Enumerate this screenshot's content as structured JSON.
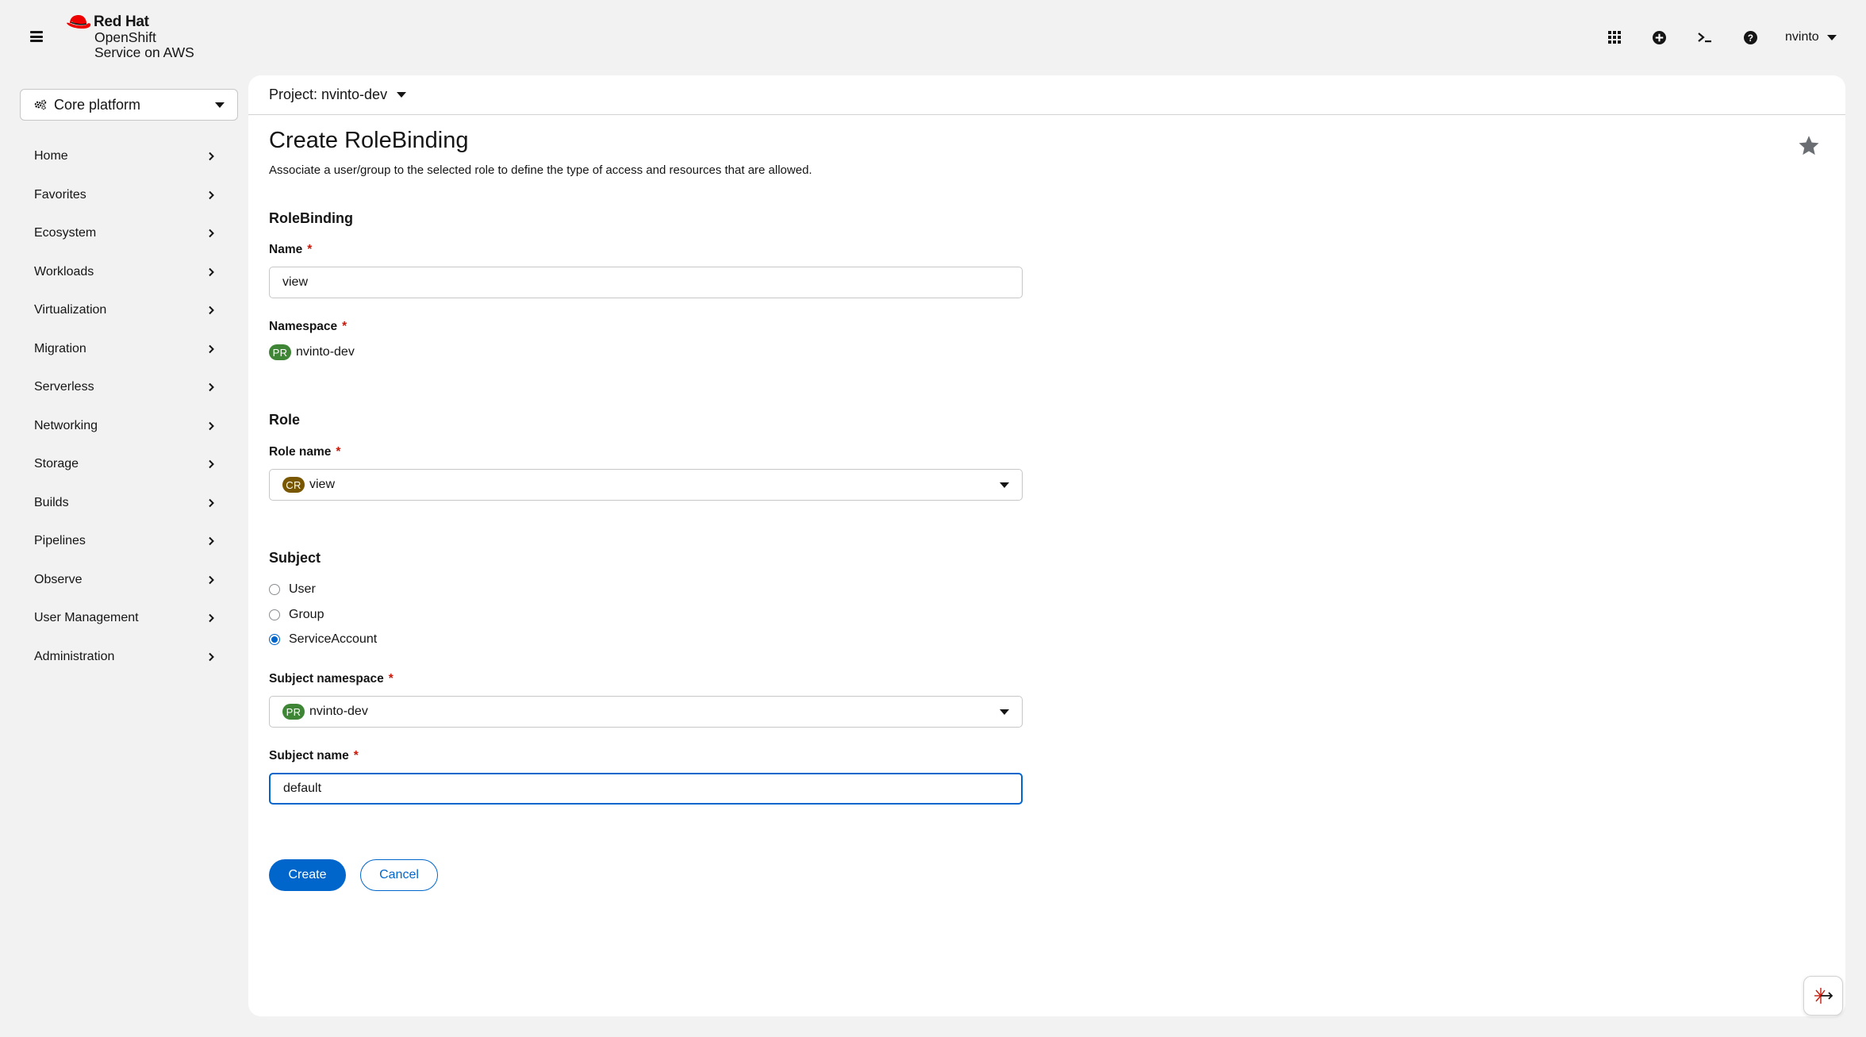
{
  "brand": {
    "company": "Red Hat",
    "product_line1": "OpenShift",
    "product_line2": "Service on AWS"
  },
  "masthead": {
    "icons": [
      "apps-grid-icon",
      "plus-circle-icon",
      "terminal-icon",
      "help-icon"
    ],
    "user": "nvinto"
  },
  "perspective": {
    "label": "Core platform"
  },
  "nav": {
    "items": [
      {
        "label": "Home"
      },
      {
        "label": "Favorites"
      },
      {
        "label": "Ecosystem"
      },
      {
        "label": "Workloads"
      },
      {
        "label": "Virtualization"
      },
      {
        "label": "Migration"
      },
      {
        "label": "Serverless"
      },
      {
        "label": "Networking"
      },
      {
        "label": "Storage"
      },
      {
        "label": "Builds"
      },
      {
        "label": "Pipelines"
      },
      {
        "label": "Observe"
      },
      {
        "label": "User Management"
      },
      {
        "label": "Administration"
      }
    ]
  },
  "project": {
    "label": "Project: nvinto-dev"
  },
  "page": {
    "title": "Create RoleBinding",
    "description": "Associate a user/group to the selected role to define the type of access and resources that are allowed."
  },
  "form": {
    "rolebinding_heading": "RoleBinding",
    "name_label": "Name",
    "name_value": "view",
    "namespace_label": "Namespace",
    "namespace_badge": "PR",
    "namespace_value": "nvinto-dev",
    "role_heading": "Role",
    "role_name_label": "Role name",
    "role_badge": "CR",
    "role_value": "view",
    "subject_heading": "Subject",
    "subject_options": [
      {
        "label": "User",
        "checked": false
      },
      {
        "label": "Group",
        "checked": false
      },
      {
        "label": "ServiceAccount",
        "checked": true
      }
    ],
    "subject_namespace_label": "Subject namespace",
    "subject_namespace_badge": "PR",
    "subject_namespace_value": "nvinto-dev",
    "subject_name_label": "Subject name",
    "subject_name_value": "default",
    "required_mark": "*"
  },
  "actions": {
    "create": "Create",
    "cancel": "Cancel"
  },
  "colors": {
    "primary": "#0066cc",
    "brand_red": "#ee0000",
    "badge_project": "#3e8635",
    "badge_clusterrole": "#795600",
    "required": "#c9190b"
  }
}
